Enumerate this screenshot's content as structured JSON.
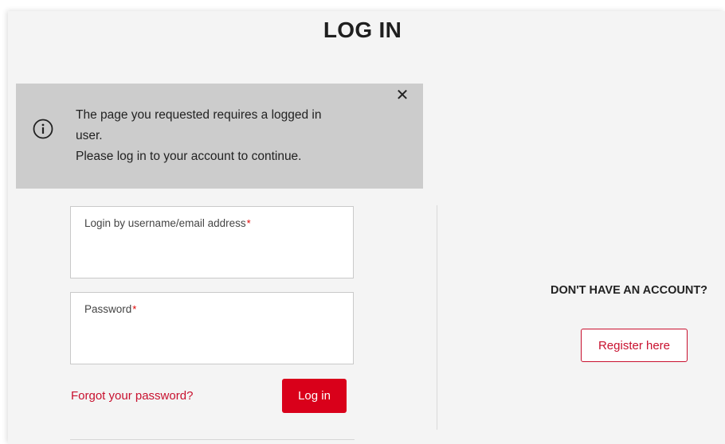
{
  "page": {
    "title": "LOG IN"
  },
  "alert": {
    "line1": "The page you requested requires a logged in user.",
    "line2": "Please log in to your account to continue.",
    "close_label": "✕",
    "icon": "info-icon"
  },
  "form": {
    "username_label": "Login by username/email address",
    "password_label": "Password",
    "required_mark": "*",
    "forgot_link": "Forgot your password?",
    "login_button": "Log in"
  },
  "register": {
    "heading": "DON'T HAVE AN ACCOUNT?",
    "button": "Register here"
  },
  "colors": {
    "brand_red": "#d9001a",
    "alert_bg": "#cccccc",
    "panel_bg": "#f4f4f4"
  }
}
